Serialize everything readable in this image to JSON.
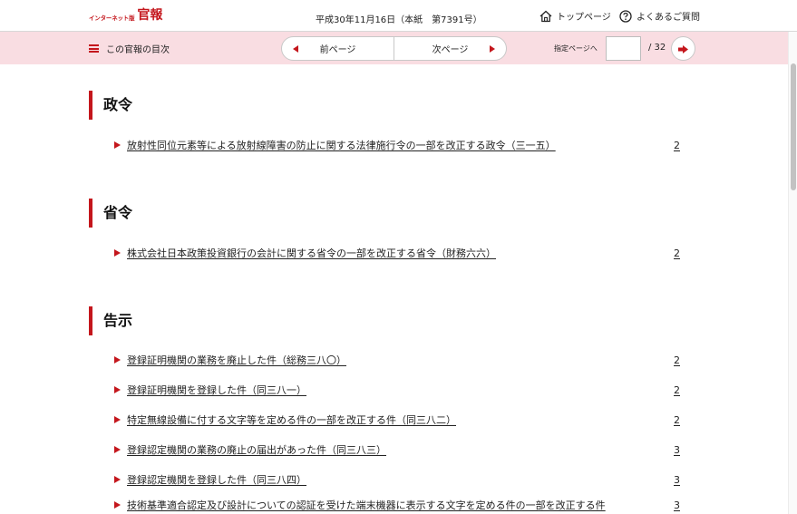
{
  "header": {
    "logo_small": "インターネット版",
    "logo_big": "官報",
    "issue_info": "平成30年11月16日（本紙　第7391号）",
    "top_page": "トップページ",
    "faq": "よくあるご質問"
  },
  "toolbar": {
    "toc_label": "この官報の目次",
    "prev_page": "前ページ",
    "next_page": "次ページ",
    "goto_label": "指定ページへ",
    "page_input_value": "",
    "total_pages": "/ 32"
  },
  "colors": {
    "accent": "#c4161c",
    "toolbar_bg": "#f9dde2"
  },
  "sections": [
    {
      "heading": "政令",
      "entries": [
        {
          "title": "放射性同位元素等による放射線障害の防止に関する法律施行令の一部を改正する政令（三一五）",
          "page": "2"
        }
      ]
    },
    {
      "heading": "省令",
      "entries": [
        {
          "title": "株式会社日本政策投資銀行の会計に関する省令の一部を改正する省令（財務六六）",
          "page": "2"
        }
      ]
    },
    {
      "heading": "告示",
      "entries": [
        {
          "title": "登録証明機関の業務を廃止した件（総務三八〇）",
          "page": "2"
        },
        {
          "title": "登録証明機関を登録した件（同三八一）",
          "page": "2"
        },
        {
          "title": "特定無線設備に付する文字等を定める件の一部を改正する件（同三八二）",
          "page": "2"
        },
        {
          "title": "登録認定機関の業務の廃止の届出があった件（同三八三）",
          "page": "3"
        },
        {
          "title": "登録認定機関を登録した件（同三八四）",
          "page": "3"
        },
        {
          "title": "技術基準適合認定及び設計についての認証を受けた端末機器に表示する文字を定める件の一部を改正する件",
          "page": "3"
        }
      ]
    }
  ]
}
